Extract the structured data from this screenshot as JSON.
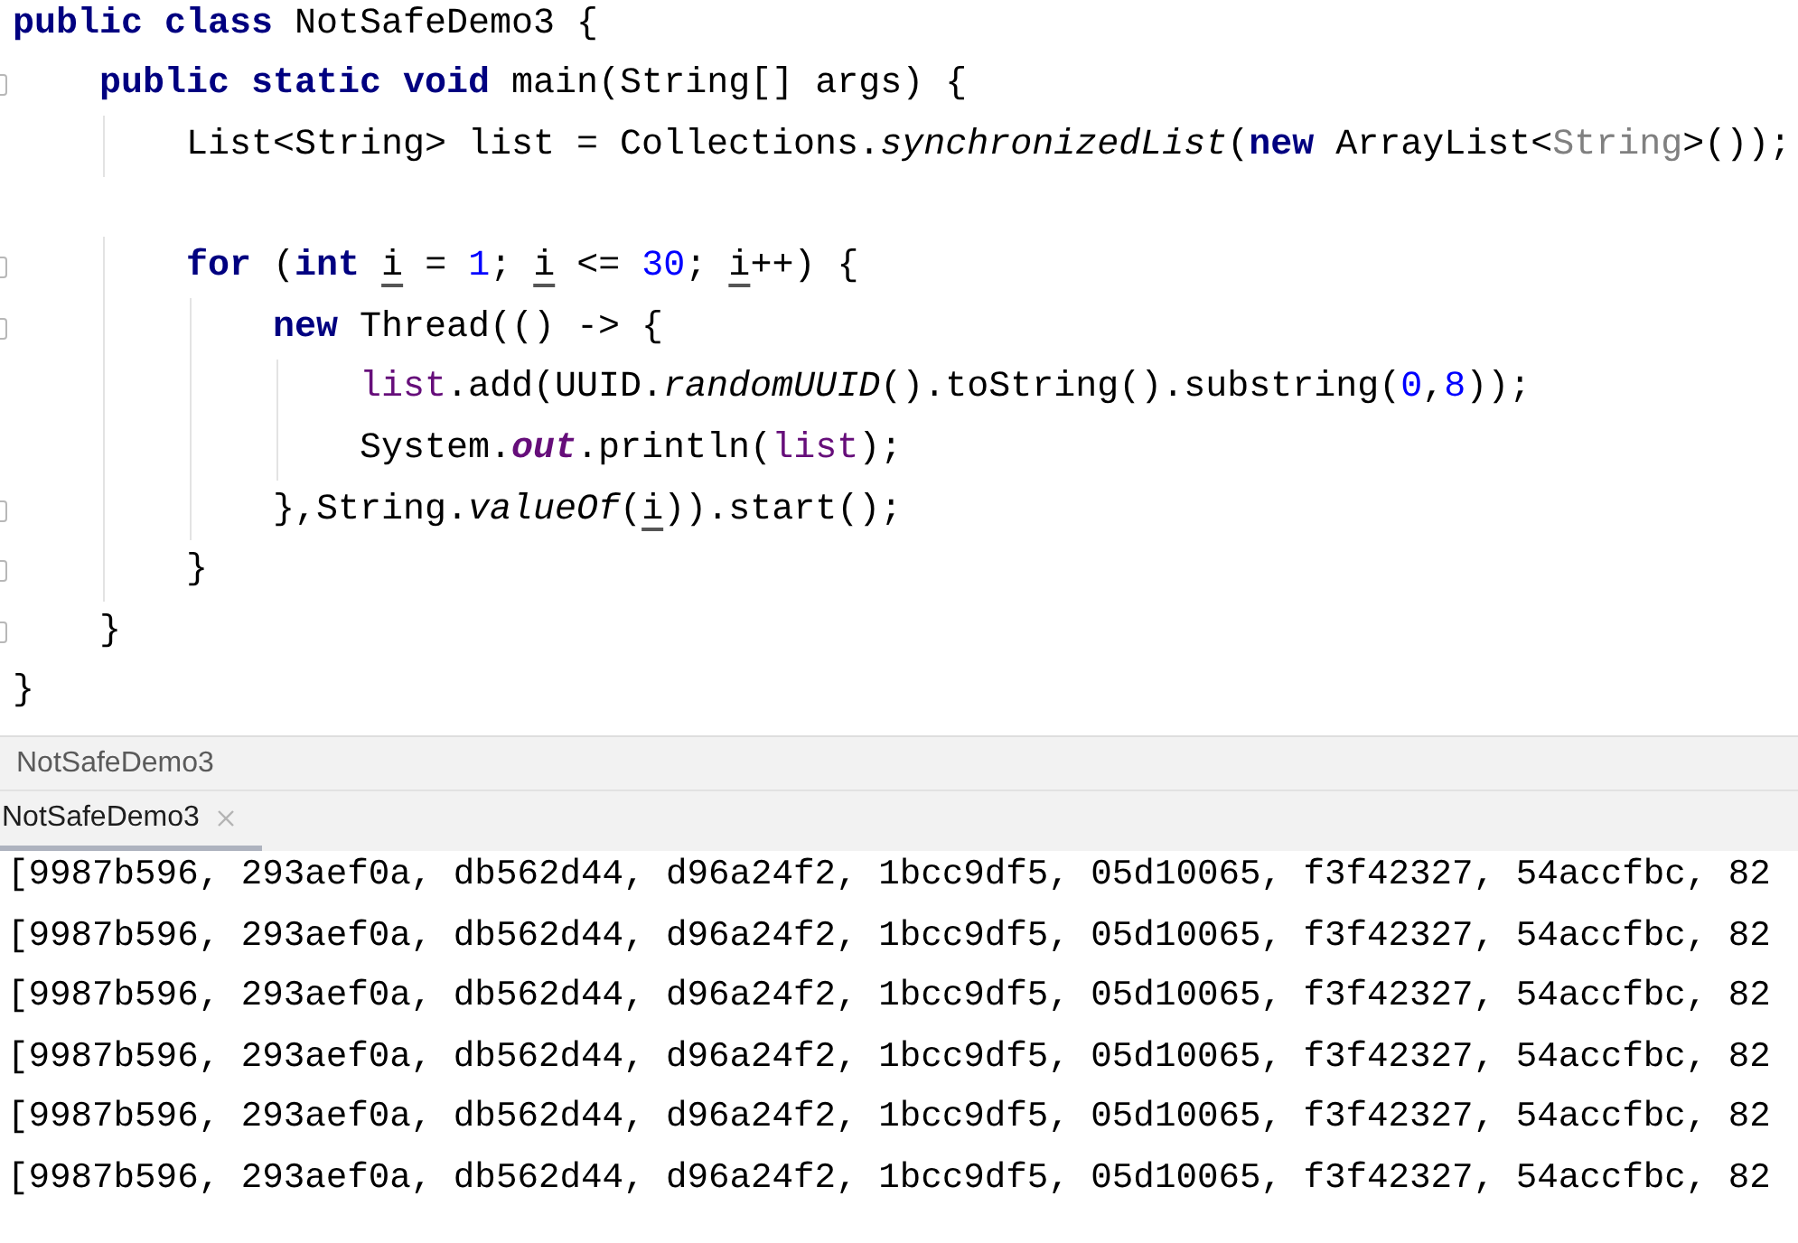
{
  "editor": {
    "lines": [
      {
        "fold_marker": false,
        "tokens": [
          {
            "kind": "keyword",
            "text": "public class"
          },
          {
            "kind": "plain",
            "text": " NotSafeDemo3 {"
          }
        ]
      },
      {
        "fold_marker": true,
        "tokens": [
          {
            "kind": "keyword",
            "text": "    public static void"
          },
          {
            "kind": "plain",
            "text": " main(String[] args) {"
          }
        ]
      },
      {
        "fold_marker": false,
        "tokens": [
          {
            "kind": "plain",
            "text": "        List<String> list = Collections."
          },
          {
            "kind": "static-call",
            "text": "synchronizedList"
          },
          {
            "kind": "plain",
            "text": "("
          },
          {
            "kind": "keyword",
            "text": "new"
          },
          {
            "kind": "plain",
            "text": " ArrayList<"
          },
          {
            "kind": "type-hint",
            "text": "String"
          },
          {
            "kind": "plain",
            "text": ">());"
          }
        ]
      },
      {
        "fold_marker": false
      },
      {
        "fold_marker": true,
        "tokens": [
          {
            "kind": "keyword",
            "text": "        for"
          },
          {
            "kind": "plain",
            "text": " ("
          },
          {
            "kind": "keyword",
            "text": "int "
          },
          {
            "kind": "reassigned-var",
            "text": "i"
          },
          {
            "kind": "plain",
            "text": " = "
          },
          {
            "kind": "number",
            "text": "1"
          },
          {
            "kind": "plain",
            "text": "; "
          },
          {
            "kind": "reassigned-var",
            "text": "i"
          },
          {
            "kind": "plain",
            "text": " <= "
          },
          {
            "kind": "number",
            "text": "30"
          },
          {
            "kind": "plain",
            "text": "; "
          },
          {
            "kind": "reassigned-var",
            "text": "i"
          },
          {
            "kind": "plain",
            "text": "++) {"
          }
        ]
      },
      {
        "fold_marker": true,
        "tokens": [
          {
            "kind": "keyword",
            "text": "            new"
          },
          {
            "kind": "plain",
            "text": " Thread(() -> {"
          }
        ]
      },
      {
        "fold_marker": false,
        "tokens": [
          {
            "kind": "captured",
            "text": "                list"
          },
          {
            "kind": "plain",
            "text": ".add(UUID."
          },
          {
            "kind": "static-call",
            "text": "randomUUID"
          },
          {
            "kind": "plain",
            "text": "().toString().substring("
          },
          {
            "kind": "number",
            "text": "0"
          },
          {
            "kind": "plain",
            "text": ","
          },
          {
            "kind": "number",
            "text": "8"
          },
          {
            "kind": "plain",
            "text": "));"
          }
        ]
      },
      {
        "fold_marker": false,
        "tokens": [
          {
            "kind": "plain",
            "text": "                System."
          },
          {
            "kind": "static-field",
            "text": "out"
          },
          {
            "kind": "plain",
            "text": ".println("
          },
          {
            "kind": "captured",
            "text": "list"
          },
          {
            "kind": "plain",
            "text": ");"
          }
        ]
      },
      {
        "fold_marker": true,
        "tokens": [
          {
            "kind": "plain",
            "text": "            },String."
          },
          {
            "kind": "static-call",
            "text": "valueOf"
          },
          {
            "kind": "plain",
            "text": "("
          },
          {
            "kind": "reassigned-var",
            "text": "i"
          },
          {
            "kind": "plain",
            "text": ")).start();"
          }
        ]
      },
      {
        "fold_marker": true,
        "tokens": [
          {
            "kind": "plain",
            "text": "        }"
          }
        ]
      },
      {
        "fold_marker": true,
        "tokens": [
          {
            "kind": "plain",
            "text": "    }"
          }
        ]
      },
      {
        "fold_marker": false,
        "tokens": [
          {
            "kind": "plain",
            "text": "}"
          }
        ]
      }
    ]
  },
  "navigation_bar": {
    "breadcrumb": "NotSafeDemo3"
  },
  "run_panel": {
    "tabs": [
      {
        "label": "NotSafeDemo3",
        "selected": true,
        "closable": true
      }
    ]
  },
  "console": {
    "lines": [
      "[9987b596, 293aef0a, db562d44, d96a24f2, 1bcc9df5, 05d10065, f3f42327, 54accfbc, 82",
      "[9987b596, 293aef0a, db562d44, d96a24f2, 1bcc9df5, 05d10065, f3f42327, 54accfbc, 82",
      "[9987b596, 293aef0a, db562d44, d96a24f2, 1bcc9df5, 05d10065, f3f42327, 54accfbc, 82",
      "[9987b596, 293aef0a, db562d44, d96a24f2, 1bcc9df5, 05d10065, f3f42327, 54accfbc, 82",
      "[9987b596, 293aef0a, db562d44, d96a24f2, 1bcc9df5, 05d10065, f3f42327, 54accfbc, 82",
      "[9987b596, 293aef0a, db562d44, d96a24f2, 1bcc9df5, 05d10065, f3f42327, 54accfbc, 82"
    ]
  }
}
